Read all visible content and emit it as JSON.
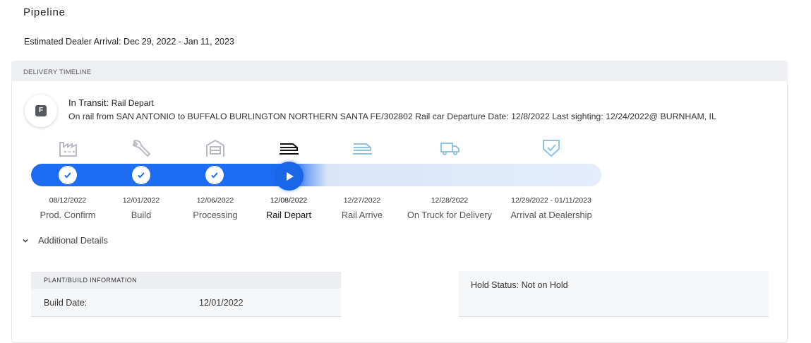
{
  "page_title": "Pipeline",
  "eta": {
    "label": "Estimated Dealer Arrival:",
    "value": "Dec 29, 2022 - Jan 11, 2023"
  },
  "timeline": {
    "header": "DELIVERY TIMELINE",
    "avatar_letter": "F",
    "status_label": "In Transit:",
    "status_value": "Rail Depart",
    "description": "On rail from SAN ANTONIO to BUFFALO BURLINGTON NORTHERN SANTA FE/302802 Rail car Departure Date: 12/8/2022 Last sighting: 12/24/2022@ BURNHAM, IL",
    "current_stage_index": 3,
    "stages": [
      {
        "label": "Prod. Confirm",
        "date": "08/12/2022",
        "icon": "factory-icon",
        "state": "complete"
      },
      {
        "label": "Build",
        "date": "12/01/2022",
        "icon": "wrench-icon",
        "state": "complete"
      },
      {
        "label": "Processing",
        "date": "12/06/2022",
        "icon": "processing-icon",
        "state": "complete"
      },
      {
        "label": "Rail Depart",
        "date": "12/08/2022",
        "icon": "rail-car-icon",
        "state": "current"
      },
      {
        "label": "Rail Arrive",
        "date": "12/27/2022",
        "icon": "rail-car-icon",
        "state": "pending"
      },
      {
        "label": "On Truck for Delivery",
        "date": "12/28/2022",
        "icon": "truck-icon",
        "state": "pending"
      },
      {
        "label": "Arrival at Dealership",
        "date": "12/29/2022 - 01/11/2023",
        "icon": "shield-check-icon",
        "state": "pending"
      }
    ],
    "colors": {
      "accent": "#1d6cf2",
      "track_pending": "#e3edfb",
      "icon_done": "#b8bcc2",
      "icon_pending": "#8fc3e0"
    }
  },
  "details": {
    "toggle_label": "Additional Details",
    "plant_header": "PLANT/BUILD INFORMATION",
    "build_date_label": "Build Date:",
    "build_date_value": "12/01/2022",
    "hold_status": "Hold Status: Not on Hold"
  }
}
